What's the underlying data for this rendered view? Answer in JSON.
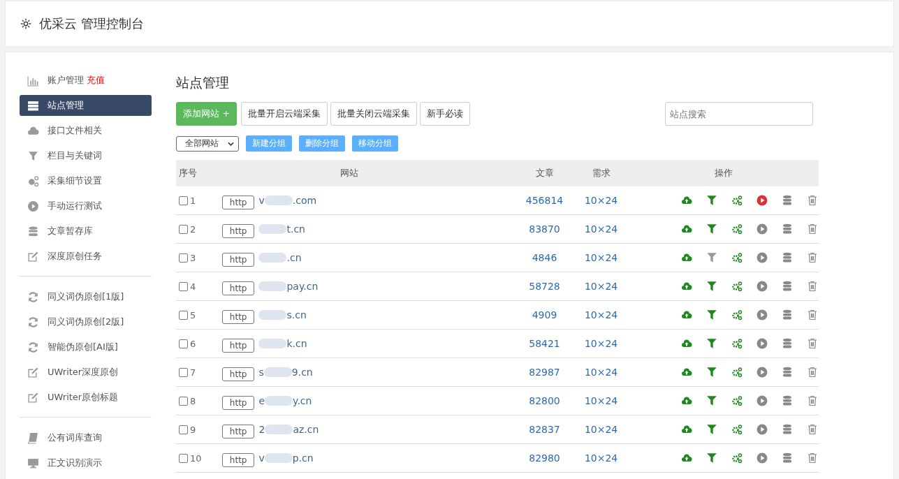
{
  "header": {
    "title": "优采云 管理控制台"
  },
  "sidebar": {
    "groups": [
      [
        {
          "label": "账户管理",
          "badge": "充值",
          "selected": false
        },
        {
          "label": "站点管理",
          "selected": true
        },
        {
          "label": "接口文件相关",
          "selected": false
        },
        {
          "label": "栏目与关键词",
          "selected": false
        },
        {
          "label": "采集细节设置",
          "selected": false
        },
        {
          "label": "手动运行测试",
          "selected": false
        },
        {
          "label": "文章暂存库",
          "selected": false
        },
        {
          "label": "深度原创任务",
          "selected": false
        }
      ],
      [
        {
          "label": "同义词伪原创[1版]",
          "selected": false
        },
        {
          "label": "同义词伪原创[2版]",
          "selected": false
        },
        {
          "label": "智能伪原创[AI版]",
          "selected": false
        },
        {
          "label": "UWriter深度原创",
          "selected": false
        },
        {
          "label": "UWriter原创标题",
          "selected": false
        }
      ],
      [
        {
          "label": "公有词库查询",
          "selected": false
        },
        {
          "label": "正文识别演示",
          "selected": false
        }
      ]
    ]
  },
  "page_title": "站点管理",
  "toolbar": {
    "add_button": "添加网站 +",
    "buttons": [
      "批量开启云端采集",
      "批量关闭云端采集",
      "新手必读"
    ],
    "search": {
      "placeholder": "站点搜索"
    }
  },
  "group_bar": {
    "filter": "全部网站",
    "buttons": [
      "新建分组",
      "删除分组",
      "移动分组"
    ]
  },
  "table": {
    "columns": [
      "序号",
      "网站",
      "文章",
      "需求",
      "操作"
    ],
    "rows": [
      {
        "no": "1",
        "scheme": "http",
        "site_start": "v",
        "site_end": ".com",
        "articles": "456814",
        "demand": "10×24",
        "checked": false,
        "filter_on": true,
        "running": true
      },
      {
        "no": "2",
        "scheme": "http",
        "site_start": "",
        "site_end": "t.cn",
        "articles": "83870",
        "demand": "10×24",
        "checked": false,
        "filter_on": true,
        "running": false
      },
      {
        "no": "3",
        "scheme": "http",
        "site_start": "",
        "site_end": ".cn",
        "articles": "4846",
        "demand": "10×24",
        "checked": false,
        "filter_on": false,
        "running": false
      },
      {
        "no": "4",
        "scheme": "http",
        "site_start": "",
        "site_end": "pay.cn",
        "articles": "58728",
        "demand": "10×24",
        "checked": false,
        "filter_on": true,
        "running": false
      },
      {
        "no": "5",
        "scheme": "http",
        "site_start": "",
        "site_end": "s.cn",
        "articles": "4909",
        "demand": "10×24",
        "checked": false,
        "filter_on": true,
        "running": false
      },
      {
        "no": "6",
        "scheme": "http",
        "site_start": "",
        "site_end": "k.cn",
        "articles": "58421",
        "demand": "10×24",
        "checked": false,
        "filter_on": true,
        "running": false
      },
      {
        "no": "7",
        "scheme": "http",
        "site_start": "s",
        "site_end": "9.cn",
        "articles": "82987",
        "demand": "10×24",
        "checked": false,
        "filter_on": true,
        "running": false
      },
      {
        "no": "8",
        "scheme": "http",
        "site_start": "e",
        "site_end": "y.cn",
        "articles": "82800",
        "demand": "10×24",
        "checked": false,
        "filter_on": true,
        "running": false
      },
      {
        "no": "9",
        "scheme": "http",
        "site_start": "2",
        "site_end": "az.cn",
        "articles": "82837",
        "demand": "10×24",
        "checked": false,
        "filter_on": true,
        "running": false
      },
      {
        "no": "10",
        "scheme": "http",
        "site_start": "v",
        "site_end": "p.cn",
        "articles": "82980",
        "demand": "10×24",
        "checked": false,
        "filter_on": true,
        "running": false
      }
    ]
  }
}
